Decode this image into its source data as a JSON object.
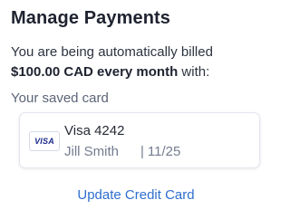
{
  "header": {
    "title": "Manage Payments"
  },
  "billing": {
    "intro": "You are being automatically billed",
    "amount": "$100.00 CAD every month",
    "suffix": " with:"
  },
  "saved_card": {
    "label": "Your saved card",
    "brand": "VISA",
    "brand_icon": "visa-logo-icon",
    "name": "Visa 4242",
    "holder": "Jill Smith",
    "separator": "|",
    "expiry": "11/25"
  },
  "actions": {
    "update_label": "Update Credit Card"
  },
  "colors": {
    "link": "#2f6fcf",
    "visa_blue": "#1a2b8c",
    "title": "#1f2330",
    "muted": "#737c8e"
  }
}
